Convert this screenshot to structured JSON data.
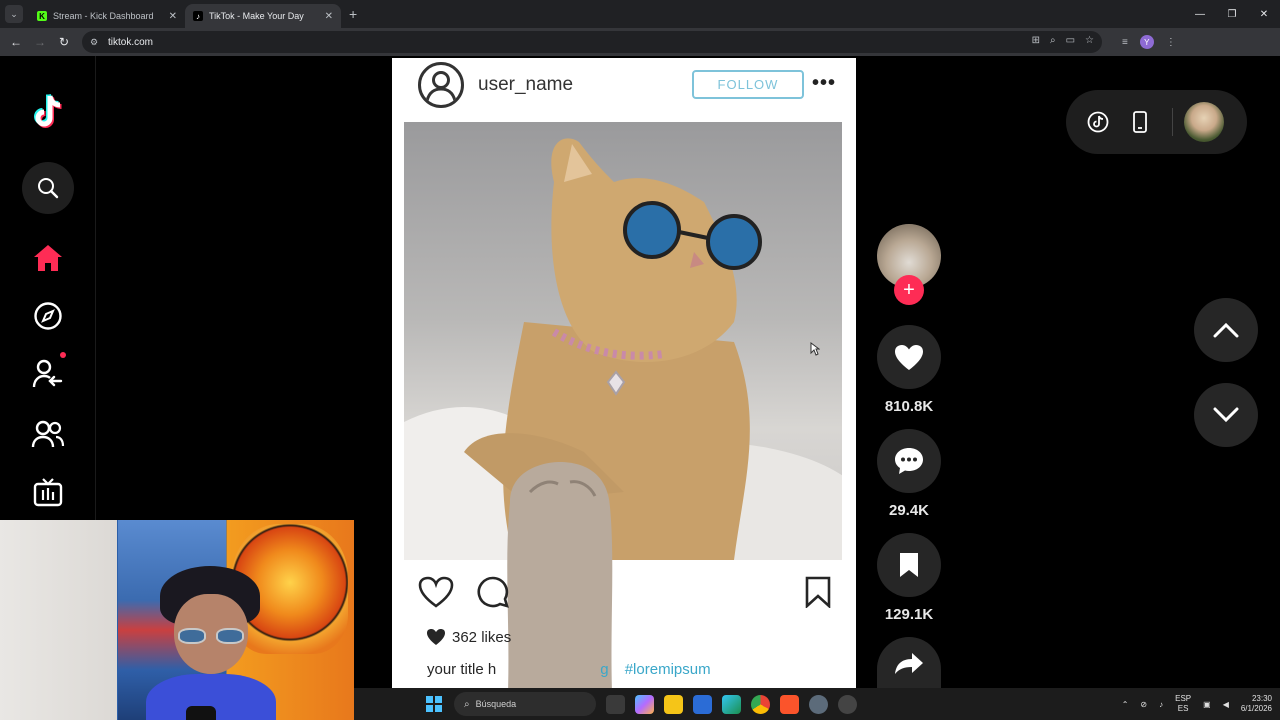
{
  "browser": {
    "tabs": [
      {
        "title": "Stream - Kick Dashboard",
        "favicon": "kick-icon",
        "active": false
      },
      {
        "title": "TikTok - Make Your Day",
        "favicon": "tiktok-icon",
        "active": true
      }
    ],
    "url": "tiktok.com"
  },
  "post": {
    "username": "user_name",
    "follow_label": "FOLLOW",
    "likes": "362 likes",
    "caption_visible_start": "your title h",
    "caption_visible_end": "g",
    "hashtag": "#loremipsum"
  },
  "actions": {
    "likes_count": "810.8K",
    "comments_count": "29.4K",
    "saves_count": "129.1K"
  },
  "taskbar": {
    "search_placeholder": "Búsqueda",
    "lang_top": "ESP",
    "lang_bottom": "ES",
    "time": "23:30",
    "date": "6/1/2026"
  },
  "colors": {
    "tiktok_red": "#fe2c55",
    "follow_blue": "#7ec3da",
    "hashtag_blue": "#3aa7c9",
    "action_bg": "#262626"
  }
}
